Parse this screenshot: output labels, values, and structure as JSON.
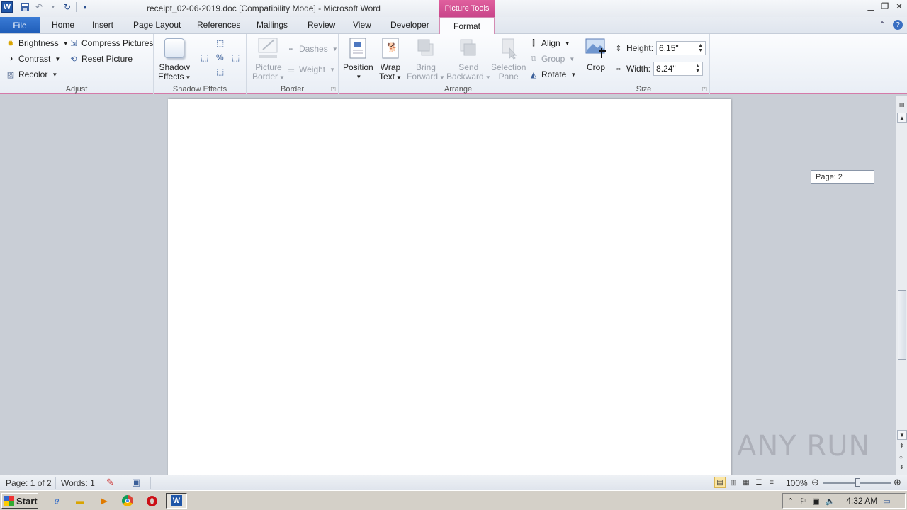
{
  "window": {
    "title": "receipt_02-06-2019.doc [Compatibility Mode]  -  Microsoft Word",
    "context_tab": "Picture Tools"
  },
  "tabs": [
    "File",
    "Home",
    "Insert",
    "Page Layout",
    "References",
    "Mailings",
    "Review",
    "View",
    "Developer",
    "Format"
  ],
  "ribbon": {
    "adjust": {
      "brightness": "Brightness",
      "contrast": "Contrast",
      "recolor": "Recolor",
      "compress": "Compress Pictures",
      "reset": "Reset Picture",
      "label": "Adjust"
    },
    "shadow": {
      "btn_line1": "Shadow",
      "btn_line2": "Effects",
      "label": "Shadow Effects"
    },
    "border": {
      "pic_line1": "Picture",
      "pic_line2": "Border",
      "dashes": "Dashes",
      "weight": "Weight",
      "label": "Border"
    },
    "arrange": {
      "position": "Position",
      "wrap_line1": "Wrap",
      "wrap_line2": "Text",
      "bring_line1": "Bring",
      "bring_line2": "Forward",
      "send_line1": "Send",
      "send_line2": "Backward",
      "sel_line1": "Selection",
      "sel_line2": "Pane",
      "align": "Align",
      "group": "Group",
      "rotate": "Rotate",
      "label": "Arrange"
    },
    "size": {
      "crop": "Crop",
      "height_label": "Height:",
      "height_value": "6.15\"",
      "width_label": "Width:",
      "width_value": "8.24\"",
      "label": "Size"
    }
  },
  "document": {
    "page_tooltip": "Page: 2"
  },
  "watermark": "ANY RUN",
  "statusbar": {
    "page": "Page: 1 of 2",
    "words": "Words: 1",
    "zoom": "100%"
  },
  "taskbar": {
    "start": "Start",
    "clock": "4:32 AM"
  }
}
